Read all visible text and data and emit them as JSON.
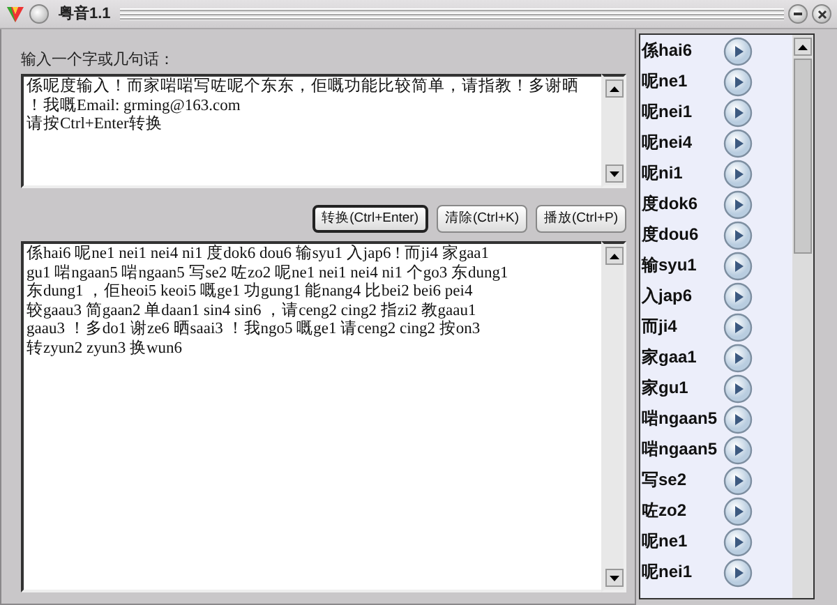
{
  "window": {
    "title": "粤音1.1"
  },
  "input": {
    "label": "输入一个字或几句话：",
    "lines": [
      "係呢度输入！而家啱啱写咗呢个东东，佢嘅功能比较简单，请指教！多谢晒",
      "！我嘅Email: grming@163.com",
      "请按Ctrl+Enter转换"
    ]
  },
  "buttons": [
    {
      "label": "转换(Ctrl+Enter)",
      "default": true
    },
    {
      "label": "清除(Ctrl+K)",
      "default": false
    },
    {
      "label": "播放(Ctrl+P)",
      "default": false
    }
  ],
  "output": {
    "lines": [
      "係hai6 呢ne1 nei1 nei4 ni1 度dok6 dou6 输syu1 入jap6 ! 而ji4 家gaa1",
      "gu1 啱ngaan5 啱ngaan5 写se2 咗zo2 呢ne1 nei1 nei4 ni1 个go3 东dung1",
      "东dung1 ，佢heoi5 keoi5 嘅ge1 功gung1 能nang4 比bei2 bei6 pei4",
      "较gaau3 简gaan2 单daan1 sin4 sin6 ，请ceng2 cing2 指zi2 教gaau1",
      "gaau3 ！多do1 谢ze6 晒saai3 ！我ngo5 嘅ge1 请ceng2 cing2 按on3",
      "转zyun2 zyun3 换wun6"
    ]
  },
  "syllables": [
    {
      "text": "係hai6"
    },
    {
      "text": "呢ne1"
    },
    {
      "text": "呢nei1"
    },
    {
      "text": "呢nei4"
    },
    {
      "text": "呢ni1"
    },
    {
      "text": "度dok6"
    },
    {
      "text": "度dou6"
    },
    {
      "text": "输syu1"
    },
    {
      "text": "入jap6"
    },
    {
      "text": "而ji4"
    },
    {
      "text": "家gaa1"
    },
    {
      "text": "家gu1"
    },
    {
      "text": "啱ngaan5"
    },
    {
      "text": "啱ngaan5"
    },
    {
      "text": "写se2"
    },
    {
      "text": "咗zo2"
    },
    {
      "text": "呢ne1"
    },
    {
      "text": "呢nei1"
    }
  ]
}
